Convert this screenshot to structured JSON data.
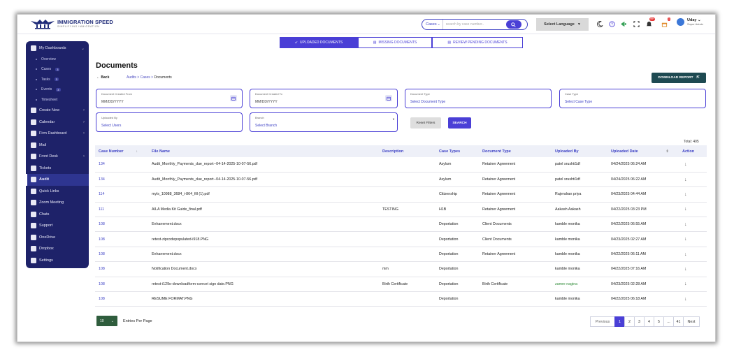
{
  "brand": {
    "name": "IMMIGRATION SPEED",
    "tagline": "SIMPLIFYING IMMIGRATION"
  },
  "header": {
    "search_scope": "Cases",
    "search_placeholder": "search by case number..",
    "language_label": "Select Language",
    "notif_badge_1": "99+",
    "notif_badge_2": "1",
    "user_name": "Uday",
    "user_role": "Super Admin"
  },
  "sidebar": {
    "items": [
      {
        "label": "My Dashboards",
        "icon": "dashboard-icon"
      },
      {
        "label": "Create New",
        "icon": "plus-square-icon"
      },
      {
        "label": "Calendar",
        "icon": "calendar-icon"
      },
      {
        "label": "Firm Dashboard",
        "icon": "building-icon"
      },
      {
        "label": "Mail",
        "icon": "mail-icon"
      },
      {
        "label": "Front Desk",
        "icon": "desk-icon"
      },
      {
        "label": "Tickets",
        "icon": "ticket-icon"
      },
      {
        "label": "Audit",
        "icon": "audit-icon"
      },
      {
        "label": "Quick Links",
        "icon": "link-icon"
      },
      {
        "label": "Zoom Meeting",
        "icon": "video-icon"
      },
      {
        "label": "Chats",
        "icon": "chat-icon"
      },
      {
        "label": "Support",
        "icon": "support-icon"
      },
      {
        "label": "OneDrive",
        "icon": "cloud-icon"
      },
      {
        "label": "Dropbox",
        "icon": "dropbox-icon"
      },
      {
        "label": "Settings",
        "icon": "gear-icon"
      }
    ],
    "sub": [
      {
        "label": "Overview",
        "count": ""
      },
      {
        "label": "Cases",
        "count": "3"
      },
      {
        "label": "Tasks",
        "count": "3"
      },
      {
        "label": "Events",
        "count": "3"
      },
      {
        "label": "Timesheet",
        "count": ""
      }
    ]
  },
  "tabs": [
    "UPLOADED DOCUMENTS",
    "MISSING DOCUMENTS",
    "REVIEW PENDING DOCUMENTS"
  ],
  "page": {
    "title": "Documents",
    "back": "Back",
    "breadcrumb": [
      "Audits",
      "Cases",
      "Documents"
    ],
    "download": "DOWNLOAD REPORT"
  },
  "filters": {
    "created_from": {
      "label": "Document Created From",
      "placeholder": "MM/DD/YYYY"
    },
    "created_to": {
      "label": "Document Created To",
      "placeholder": "MM/DD/YYYY"
    },
    "doc_type": {
      "label": "Document Type",
      "value": "Select Document Type"
    },
    "case_type": {
      "label": "Case Type",
      "value": "Select Case Type"
    },
    "uploaded_by": {
      "label": "Uploaded By",
      "value": "Select Users"
    },
    "branch": {
      "label": "Branch",
      "value": "Select Branch"
    },
    "reset": "Reset Filters",
    "search": "SEARCH"
  },
  "total": "Total: 405",
  "table": {
    "columns": [
      "Case Number",
      "File Name",
      "Description",
      "Case Types",
      "Document Type",
      "Uploaded By",
      "Uploaded Date",
      "Action"
    ],
    "rows": [
      [
        "134",
        "Audit_Monthly_Payments_due_report--04-14-2025-10-07-56.pdf",
        "",
        "Asylum",
        "Retainer Agreement",
        "patel srushti1df",
        "04/24/2025 06:24 AM"
      ],
      [
        "134",
        "Audit_Monthly_Payments_due_report--04-14-2025-10-07-56.pdf",
        "",
        "Asylum",
        "Retainer Agreement",
        "patel srushti1df",
        "04/24/2025 06:22 AM"
      ],
      [
        "114",
        "myls_10988_3684_i-864_fill (1).pdf",
        "",
        "Citizenship",
        "Retainer Agreement",
        "Rajendran priya",
        "04/23/2025 04:44 AM"
      ],
      [
        "111",
        "AILA Media Kit Guide_final.pdf",
        "TESTING",
        "H1B",
        "Retainer Agreement",
        "Aakash Aakash",
        "04/22/2025 03:23 PM"
      ],
      [
        "108",
        "Enhanement.docx",
        "",
        "Deportation",
        "Client Documents",
        "kamble monika",
        "04/22/2025 06:55 AM"
      ],
      [
        "108",
        "retest-zipcodepopulated-i918.PNG",
        "",
        "Deportation",
        "Client Documents",
        "kamble monika",
        "04/23/2025 02:27 AM"
      ],
      [
        "108",
        "Enhanement.docx",
        "",
        "Deportation",
        "Retainer Agreement",
        "kamble monika",
        "04/22/2025 06:11 AM"
      ],
      [
        "108",
        "Notification Document.docx",
        "mm",
        "Deportation",
        "",
        "kamble monika",
        "04/22/2025 07:16 AM"
      ],
      [
        "108",
        "retest-i129o-downloadform-corrcet sign date.PNG",
        "Birth Certificate",
        "Deportation",
        "Birth Certificate",
        "zamre nagina",
        "04/23/2025 02:28 AM"
      ],
      [
        "108",
        "RESUME FORMAT.PNG",
        "",
        "Deportation",
        "",
        "kamble monika",
        "04/22/2025 06:18 AM"
      ]
    ]
  },
  "pagination": {
    "per_page": "10",
    "per_page_label": "Entries Per Page",
    "prev": "Previous",
    "pages": [
      "1",
      "2",
      "3",
      "4",
      "5",
      "...",
      "41"
    ],
    "next": "Next",
    "current": "1"
  },
  "colors": {
    "primary": "#4a3fd6",
    "sidebar": "#1e2269",
    "download": "#1e4a52",
    "green": "#2f5d3d"
  }
}
